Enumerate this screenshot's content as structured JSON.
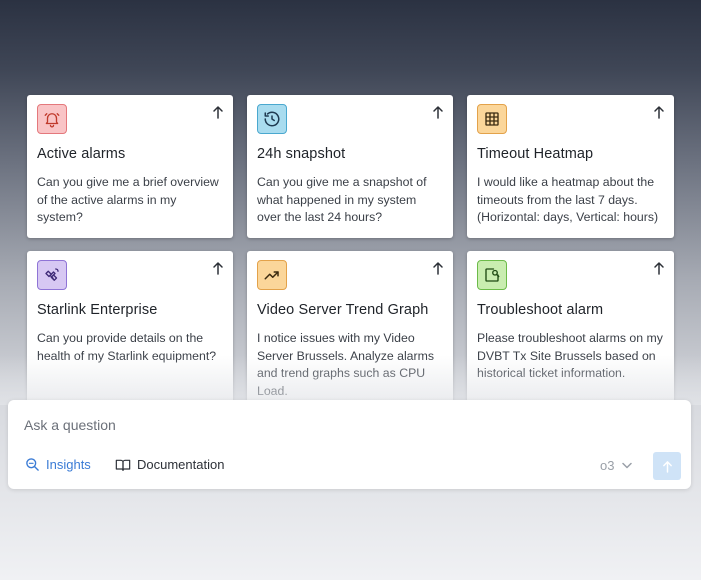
{
  "cards": [
    {
      "icon": "bell-icon",
      "title": "Active alarms",
      "description": "Can you give me a brief overview of the active alarms in my system?"
    },
    {
      "icon": "history-icon",
      "title": "24h snapshot",
      "description": "Can you give me a snapshot of what happened in my system over the last 24 hours?"
    },
    {
      "icon": "grid-icon",
      "title": "Timeout Heatmap",
      "description": "I would like a heatmap about the timeouts from the last 7 days. (Horizontal: days, Vertical: hours)"
    },
    {
      "icon": "satellite-icon",
      "title": "Starlink Enterprise",
      "description": "Can you provide details on the health of my Starlink equipment?"
    },
    {
      "icon": "trending-up-icon",
      "title": "Video Server Trend Graph",
      "description": "I notice issues with my Video Server Brussels. Analyze alarms and trend graphs such as CPU Load."
    },
    {
      "icon": "troubleshoot-icon",
      "title": "Troubleshoot alarm",
      "description": "Please troubleshoot alarms on my DVBT Tx Site Brussels based on historical ticket information."
    }
  ],
  "ask": {
    "placeholder": "Ask a question",
    "insights_label": "Insights",
    "documentation_label": "Documentation",
    "model": "o3"
  },
  "colors": {
    "insights_accent": "#3a7bd5",
    "send_button": "#cfe3f7"
  }
}
